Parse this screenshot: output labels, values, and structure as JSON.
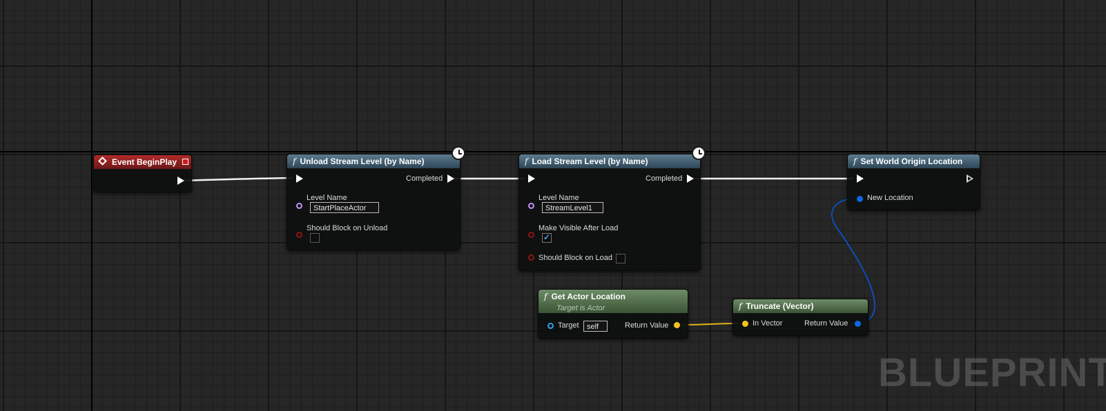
{
  "watermark": "BLUEPRINT",
  "colors": {
    "exec_wire": "#ffffff",
    "vector_wire": "#0d4fb8",
    "float_wire": "#f4c11f",
    "event_header": "#b02a2a",
    "function_header": "#5d7b8f",
    "pure_header": "#6d8c66"
  },
  "nodes": {
    "event_begin_play": {
      "title": "Event BeginPlay"
    },
    "unload_stream_level": {
      "title": "Unload Stream Level (by Name)",
      "completed_label": "Completed",
      "level_name_label": "Level Name",
      "level_name_value": "StartPlaceActor",
      "should_block_label": "Should Block on Unload"
    },
    "load_stream_level": {
      "title": "Load Stream Level (by Name)",
      "completed_label": "Completed",
      "level_name_label": "Level Name",
      "level_name_value": "StreamLevel1",
      "make_visible_label": "Make Visible After Load",
      "make_visible_checked": true,
      "should_block_label": "Should Block on Load"
    },
    "set_world_origin": {
      "title": "Set World Origin Location",
      "new_location_label": "New Location"
    },
    "get_actor_location": {
      "title": "Get Actor Location",
      "subtitle": "Target is Actor",
      "target_label": "Target",
      "target_value": "self",
      "return_label": "Return Value"
    },
    "truncate_vector": {
      "title": "Truncate (Vector)",
      "in_label": "In Vector",
      "return_label": "Return Value"
    }
  }
}
